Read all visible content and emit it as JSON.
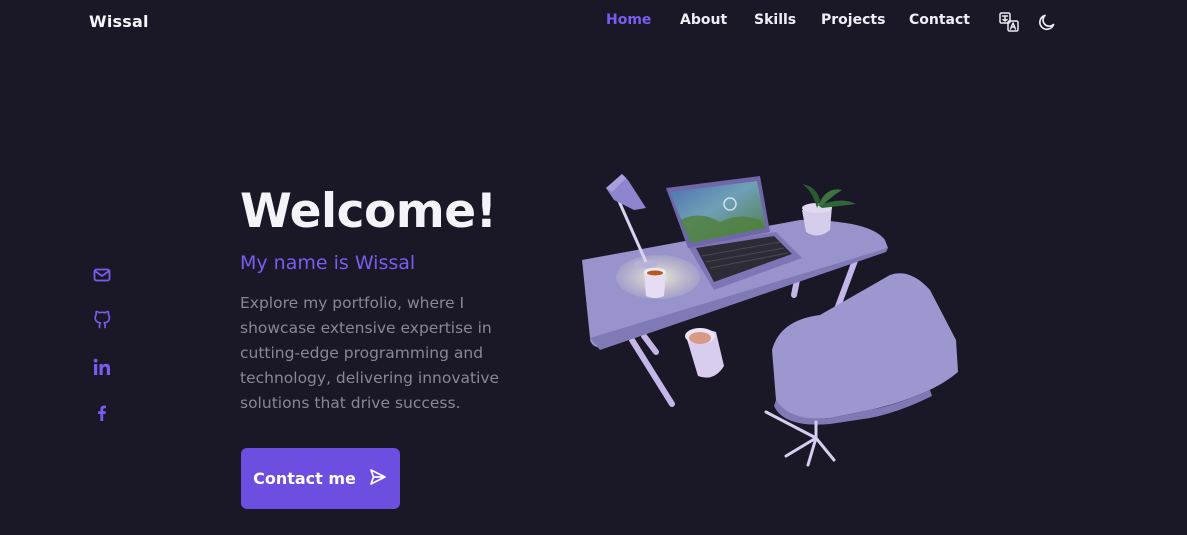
{
  "header": {
    "logo": "Wissal",
    "nav": [
      {
        "label": "Home",
        "active": true
      },
      {
        "label": "About",
        "active": false
      },
      {
        "label": "Skills",
        "active": false
      },
      {
        "label": "Projects",
        "active": false
      },
      {
        "label": "Contact",
        "active": false
      }
    ],
    "icons": [
      "translate-icon",
      "moon-icon"
    ]
  },
  "social": [
    "mail-icon",
    "github-icon",
    "linkedin-icon",
    "facebook-icon"
  ],
  "hero": {
    "title": "Welcome!",
    "subtitle": "My name is Wissal",
    "description": "Explore my portfolio, where I showcase extensive expertise in cutting-edge programming and technology, delivering innovative solutions that drive success.",
    "cta_label": "Contact me",
    "cta_icon": "send-icon"
  },
  "colors": {
    "background": "#1a1726",
    "accent": "#6c4fe0",
    "accent_text": "#7b5cf0",
    "muted_text": "#8a8697",
    "scene_primary": "#9b96cf"
  }
}
